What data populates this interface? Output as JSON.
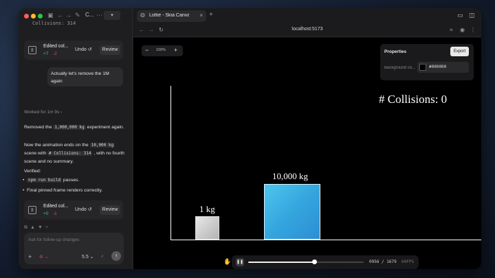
{
  "sidebar": {
    "tab_label": "C...",
    "pill_label": "▾",
    "truncated_text": "Collisions: 314",
    "card1": {
      "title": "Edited col...",
      "added": "+7",
      "removed": "-2",
      "undo": "Undo ↺",
      "review": "Review"
    },
    "user_message": "Actually let's remove the 1M again",
    "worked_for": "Worked for 1m 9s  ›",
    "p1_a": "Removed the ",
    "p1_code": "1,000,000 kg",
    "p1_b": " experiment again.",
    "p2_a": "Now the animation ends on the ",
    "p2_code1": "10,000 kg",
    "p2_b": " scene with ",
    "p2_code2": "# Collisions: 314",
    "p2_c": " , with no fourth scene and no summary.",
    "verified": "Verified:",
    "bullet1_code": "npm run build",
    "bullet1_text": " passes.",
    "bullet2": "Final pinned frame renders correctly.",
    "card2": {
      "title": "Edited col...",
      "added": "+0",
      "removed": "-1",
      "undo": "Undo ↺",
      "review": "Review"
    },
    "input_placeholder": "Ask for follow-up changes",
    "model_version": "5.5 ⌄"
  },
  "browser": {
    "tab_title": "Lottie - Skia Canvas",
    "url": "localhost:5173"
  },
  "canvas": {
    "zoom_value": "100%",
    "properties_title": "Properties",
    "export_label": "Export",
    "bg_label": "Background co...",
    "bg_value": "#000000",
    "bg_color": "#000000",
    "collisions_text": "# Collisions: 0",
    "small_box_label": "1 kg",
    "big_box_label": "10,000 kg"
  },
  "player": {
    "frames": "0956 / 1679",
    "fps": "60FPS",
    "progress": 0.569
  }
}
